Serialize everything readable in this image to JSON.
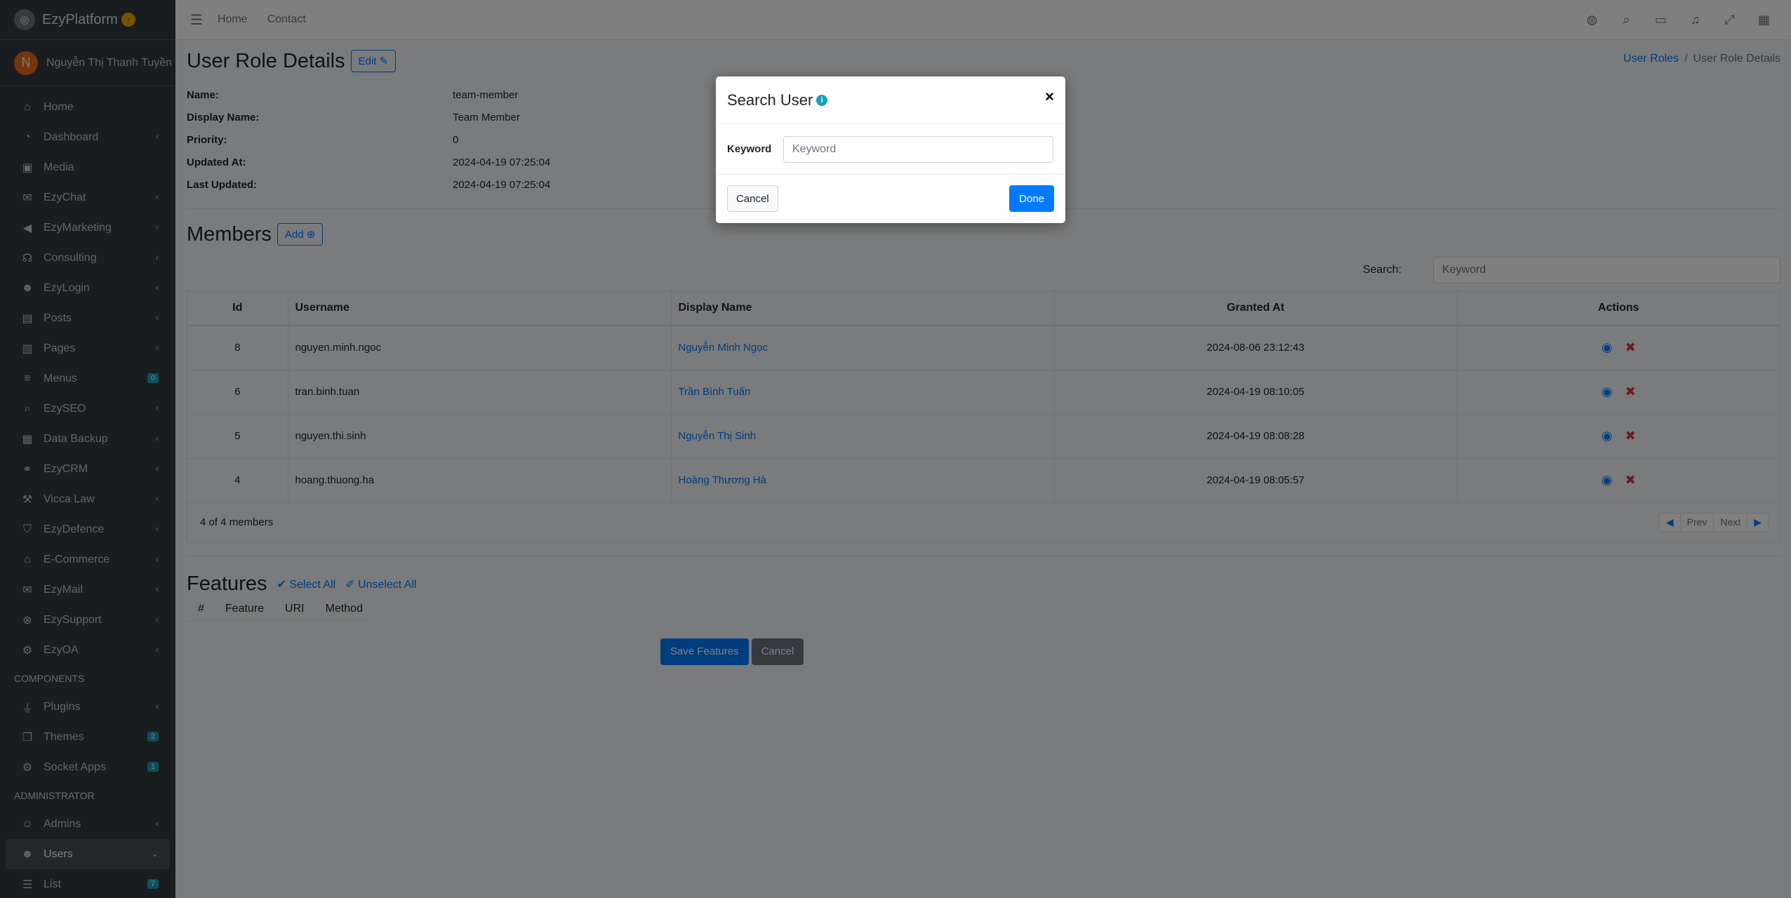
{
  "brand": {
    "name": "EzyPlatform",
    "badge_icon": "arrow-up-circle-icon"
  },
  "user": {
    "initial": "N",
    "name": "Nguyễn Thị Thanh Tuyền"
  },
  "sidebar": {
    "items": [
      {
        "label": "Home",
        "icon": "home-icon",
        "glyph": "⌂",
        "chevron": false
      },
      {
        "label": "Dashboard",
        "icon": "dashboard-icon",
        "glyph": "◔",
        "chevron": true
      },
      {
        "label": "Media",
        "icon": "image-icon",
        "glyph": "▣",
        "chevron": false
      },
      {
        "label": "EzyChat",
        "icon": "chat-icon",
        "glyph": "✉",
        "chevron": true
      },
      {
        "label": "EzyMarketing",
        "icon": "megaphone-icon",
        "glyph": "◀",
        "chevron": true
      },
      {
        "label": "Consulting",
        "icon": "headset-icon",
        "glyph": "☊",
        "chevron": true
      },
      {
        "label": "EzyLogin",
        "icon": "user-lock-icon",
        "glyph": "☻",
        "chevron": true
      },
      {
        "label": "Posts",
        "icon": "posts-icon",
        "glyph": "▤",
        "chevron": true
      },
      {
        "label": "Pages",
        "icon": "book-icon",
        "glyph": "▥",
        "chevron": true
      },
      {
        "label": "Menus",
        "icon": "bars-icon",
        "glyph": "≡",
        "chevron": false,
        "badge": "0"
      },
      {
        "label": "EzySEO",
        "icon": "search-plus-icon",
        "glyph": "⌕",
        "chevron": true
      },
      {
        "label": "Data Backup",
        "icon": "database-icon",
        "glyph": "▦",
        "chevron": true
      },
      {
        "label": "EzyCRM",
        "icon": "handshake-icon",
        "glyph": "⚭",
        "chevron": true
      },
      {
        "label": "Vicca Law",
        "icon": "gavel-icon",
        "glyph": "⚒",
        "chevron": true
      },
      {
        "label": "EzyDefence",
        "icon": "shield-icon",
        "glyph": "⛉",
        "chevron": true
      },
      {
        "label": "E-Commerce",
        "icon": "shop-icon",
        "glyph": "⌂",
        "chevron": true
      },
      {
        "label": "EzyMail",
        "icon": "envelope-icon",
        "glyph": "✉",
        "chevron": true
      },
      {
        "label": "EzySupport",
        "icon": "life-ring-icon",
        "glyph": "⊗",
        "chevron": true
      },
      {
        "label": "EzyOA",
        "icon": "gear-icon",
        "glyph": "⚙",
        "chevron": true
      }
    ],
    "components_header": "COMPONENTS",
    "components": [
      {
        "label": "Plugins",
        "icon": "plug-icon",
        "glyph": "⏚",
        "chevron": true
      },
      {
        "label": "Themes",
        "icon": "layers-icon",
        "glyph": "❐",
        "chevron": false,
        "badge": "2"
      },
      {
        "label": "Socket Apps",
        "icon": "cogs-icon",
        "glyph": "⚙",
        "chevron": false,
        "badge": "1"
      }
    ],
    "admin_header": "ADMINISTRATOR",
    "admin": [
      {
        "label": "Admins",
        "icon": "user-circle-icon",
        "glyph": "☺",
        "chevron": true
      },
      {
        "label": "Users",
        "icon": "users-icon",
        "glyph": "☻",
        "chevron": true,
        "active": true
      },
      {
        "label": "List",
        "icon": "list-icon",
        "glyph": "☰",
        "chevron": false,
        "badge": "7"
      }
    ]
  },
  "topbar": {
    "links": [
      "Home",
      "Contact"
    ],
    "right_icons": [
      "globe-icon",
      "search-icon",
      "comments-icon",
      "bell-icon",
      "expand-icon",
      "apps-icon"
    ]
  },
  "page": {
    "title": "User Role Details",
    "edit_label": "Edit",
    "breadcrumb": {
      "parent": "User Roles",
      "current": "User Role Details"
    },
    "details": [
      {
        "label": "Name:",
        "value": "team-member"
      },
      {
        "label": "Display Name:",
        "value": "Team Member"
      },
      {
        "label": "Priority:",
        "value": "0"
      },
      {
        "label": "Updated At:",
        "value": "2024-04-19 07:25:04"
      },
      {
        "label": "Last Updated:",
        "value": "2024-04-19 07:25:04"
      }
    ]
  },
  "members": {
    "title": "Members",
    "add_label": "Add",
    "search_label": "Search:",
    "search_placeholder": "Keyword",
    "columns": [
      "Id",
      "Username",
      "Display Name",
      "Granted At",
      "Actions"
    ],
    "rows": [
      {
        "id": "8",
        "username": "nguyen.minh.ngoc",
        "display_name": "Nguyễn Minh Ngọc",
        "granted_at": "2024-08-06 23:12:43"
      },
      {
        "id": "6",
        "username": "tran.binh.tuan",
        "display_name": "Trần Bình Tuấn",
        "granted_at": "2024-04-19 08:10:05"
      },
      {
        "id": "5",
        "username": "nguyen.thi.sinh",
        "display_name": "Nguyễn Thị Sinh",
        "granted_at": "2024-04-19 08:08:28"
      },
      {
        "id": "4",
        "username": "hoang.thuong.ha",
        "display_name": "Hoàng Thương Hà",
        "granted_at": "2024-04-19 08:05:57"
      }
    ],
    "summary": "4 of 4 members",
    "pager": {
      "prev": "Prev",
      "next": "Next"
    }
  },
  "features": {
    "title": "Features",
    "select_all": "Select All",
    "unselect_all": "Unselect All",
    "columns": [
      "#",
      "Feature",
      "URI",
      "Method"
    ],
    "save_label": "Save Features",
    "cancel_label": "Cancel"
  },
  "modal": {
    "title": "Search User",
    "keyword_label": "Keyword",
    "keyword_placeholder": "Keyword",
    "cancel_label": "Cancel",
    "done_label": "Done",
    "close_glyph": "×"
  }
}
